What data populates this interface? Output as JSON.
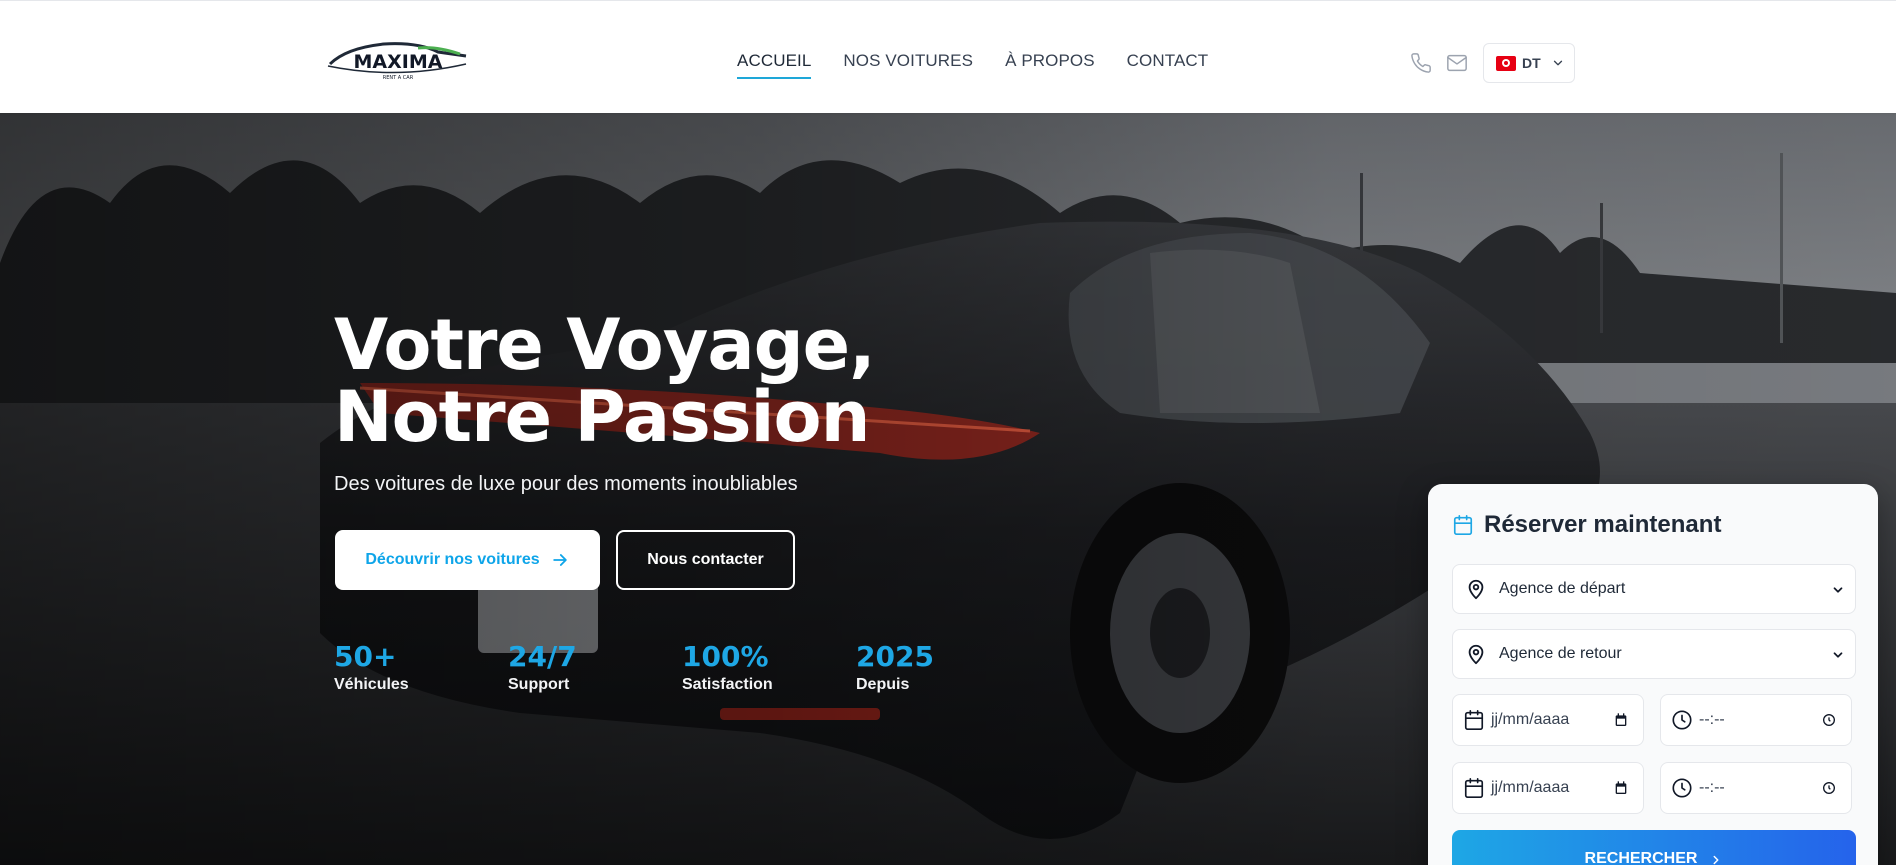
{
  "brand": {
    "name": "MAXIMA",
    "tagline": "RENT A CAR"
  },
  "nav": {
    "items": [
      {
        "label": "ACCUEIL",
        "active": true
      },
      {
        "label": "NOS VOITURES",
        "active": false
      },
      {
        "label": "À PROPOS",
        "active": false
      },
      {
        "label": "CONTACT",
        "active": false
      }
    ]
  },
  "header": {
    "icons": [
      "phone-icon",
      "mail-icon"
    ],
    "currency": {
      "label": "DT",
      "flag": "tunisia-flag-icon"
    }
  },
  "hero": {
    "title_line1": "Votre Voyage,",
    "title_line2": "Notre Passion",
    "subtitle": "Des voitures de luxe pour des moments inoubliables",
    "primary_button": "Découvrir nos voitures",
    "secondary_button": "Nous contacter",
    "stats": [
      {
        "value": "50+",
        "label": "Véhicules"
      },
      {
        "value": "24/7",
        "label": "Support"
      },
      {
        "value": "100%",
        "label": "Satisfaction"
      },
      {
        "value": "2025",
        "label": "Depuis"
      }
    ]
  },
  "booking": {
    "title": "Réserver maintenant",
    "departure_select": "Agence de départ",
    "return_select": "Agence de retour",
    "pickup_date": "jj/mm/aaaa",
    "pickup_time": "--:--",
    "return_date": "jj/mm/aaaa",
    "return_time": "--:--",
    "search_button": "RECHERCHER"
  },
  "colors": {
    "accent": "#1ea7e5",
    "accent_dark": "#2563eb",
    "text_dark": "#1f2937"
  }
}
